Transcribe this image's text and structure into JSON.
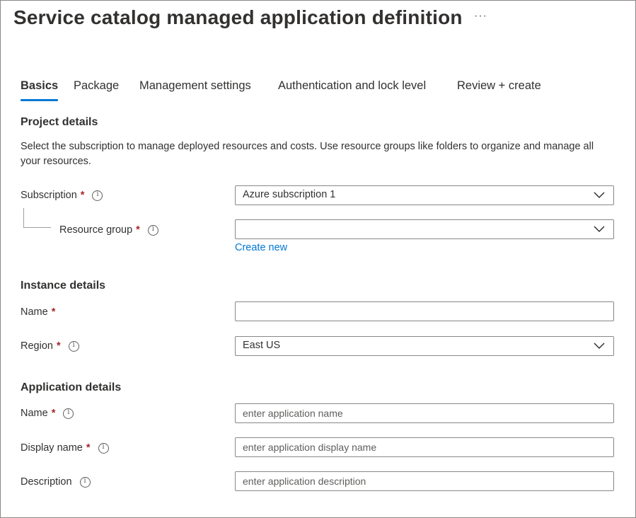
{
  "header": {
    "title": "Service catalog managed application definition",
    "more_label": "···"
  },
  "tabs": [
    {
      "label": "Basics",
      "active": true
    },
    {
      "label": "Package"
    },
    {
      "label": "Management settings"
    },
    {
      "label": "Authentication and lock level"
    },
    {
      "label": "Review + create"
    }
  ],
  "project": {
    "heading": "Project details",
    "description": "Select the subscription to manage deployed resources and costs. Use resource groups like folders to organize and manage all your resources.",
    "subscription": {
      "label": "Subscription",
      "required": "*",
      "value": "Azure subscription 1"
    },
    "resource_group": {
      "label": "Resource group",
      "required": "*",
      "value": "",
      "create_new": "Create new"
    }
  },
  "instance": {
    "heading": "Instance details",
    "name": {
      "label": "Name",
      "required": "*",
      "value": ""
    },
    "region": {
      "label": "Region",
      "required": "*",
      "value": "East US"
    }
  },
  "application": {
    "heading": "Application details",
    "name": {
      "label": "Name",
      "required": "*",
      "placeholder": "enter application name"
    },
    "display_name": {
      "label": "Display name",
      "required": "*",
      "placeholder": "enter application display name"
    },
    "description": {
      "label": "Description",
      "placeholder": "enter application description"
    }
  },
  "icons": {
    "info": "info-icon",
    "dropdown": "chevron-down-icon",
    "more": "more-icon"
  },
  "colors": {
    "accent": "#0078d4",
    "required": "#a4262c",
    "border": "#8a8886"
  }
}
